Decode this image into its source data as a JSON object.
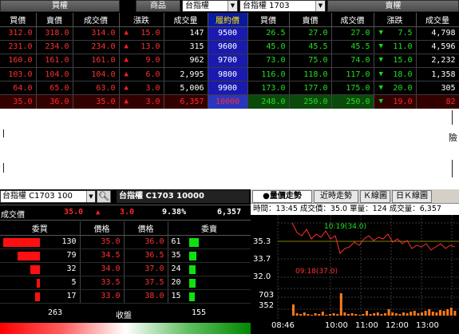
{
  "header": {
    "buy_call_label": "買權",
    "product_label": "商品",
    "product_select": "台指權",
    "contract_select": "台指權  1703",
    "sell_put_label": "賣權"
  },
  "quote_table": {
    "columns": [
      "買價",
      "賣價",
      "成交價",
      "漲跌",
      "成交量",
      "履約價",
      "買價",
      "賣價",
      "成交價",
      "漲跌",
      "成交量"
    ],
    "rows": [
      {
        "c_bid": "312.0",
        "c_ask": "318.0",
        "c_last": "314.0",
        "c_dir": "up",
        "c_chg": "15.0",
        "c_vol": "147",
        "strike": "9500",
        "p_bid": "26.5",
        "p_ask": "27.0",
        "p_last": "27.0",
        "p_dir": "down",
        "p_chg": "7.5",
        "p_vol": "4,798"
      },
      {
        "c_bid": "231.0",
        "c_ask": "234.0",
        "c_last": "234.0",
        "c_dir": "up",
        "c_chg": "13.0",
        "c_vol": "315",
        "strike": "9600",
        "p_bid": "45.0",
        "p_ask": "45.5",
        "p_last": "45.5",
        "p_dir": "down",
        "p_chg": "11.0",
        "p_vol": "4,596"
      },
      {
        "c_bid": "160.0",
        "c_ask": "161.0",
        "c_last": "161.0",
        "c_dir": "up",
        "c_chg": "9.0",
        "c_vol": "962",
        "strike": "9700",
        "p_bid": "73.0",
        "p_ask": "75.0",
        "p_last": "74.0",
        "p_dir": "down",
        "p_chg": "15.0",
        "p_vol": "2,232"
      },
      {
        "c_bid": "103.0",
        "c_ask": "104.0",
        "c_last": "104.0",
        "c_dir": "up",
        "c_chg": "6.0",
        "c_vol": "2,995",
        "strike": "9800",
        "p_bid": "116.0",
        "p_ask": "118.0",
        "p_last": "117.0",
        "p_dir": "down",
        "p_chg": "18.0",
        "p_vol": "1,358"
      },
      {
        "c_bid": "64.0",
        "c_ask": "65.0",
        "c_last": "63.0",
        "c_dir": "up",
        "c_chg": "3.0",
        "c_vol": "5,006",
        "strike": "9900",
        "p_bid": "173.0",
        "p_ask": "177.0",
        "p_last": "175.0",
        "p_dir": "down",
        "p_chg": "20.0",
        "p_vol": "305"
      },
      {
        "c_bid": "35.0",
        "c_ask": "36.0",
        "c_last": "35.0",
        "c_dir": "up",
        "c_chg": "3.0",
        "c_vol": "6,357",
        "strike": "10000",
        "p_bid": "248.0",
        "p_ask": "250.0",
        "p_last": "250.0",
        "p_dir": "down",
        "p_chg": "19.0",
        "p_vol": "82"
      }
    ]
  },
  "blank_area": {
    "edge_text": "險"
  },
  "detail": {
    "contract_select": "台指權  C1703  100",
    "title": "台指權  C1703  10000",
    "last_label": "成交價",
    "last_price": "35.0",
    "change": "3.0",
    "change_pct": "9.38%",
    "volume": "6,357"
  },
  "order_book": {
    "headers": [
      "委買",
      "價格",
      "價格",
      "委賣"
    ],
    "rows": [
      {
        "bid_qty": "130",
        "bid_px": "35.0",
        "ask_px": "36.0",
        "ask_qty": "61"
      },
      {
        "bid_qty": "79",
        "bid_px": "34.5",
        "ask_px": "36.5",
        "ask_qty": "35"
      },
      {
        "bid_qty": "32",
        "bid_px": "34.0",
        "ask_px": "37.0",
        "ask_qty": "24"
      },
      {
        "bid_qty": "5",
        "bid_px": "33.5",
        "ask_px": "37.5",
        "ask_qty": "20"
      },
      {
        "bid_qty": "17",
        "bid_px": "33.0",
        "ask_px": "38.0",
        "ask_qty": "15"
      }
    ],
    "total_bid": "263",
    "close_label": "收盤",
    "total_ask": "155"
  },
  "chart_tabs": [
    "●量價走勢",
    "近時走勢",
    "Ｋ線圖",
    "日Ｋ線圖"
  ],
  "chart_info": "時間：13:45  成交價：35.0  單量：124  成交量：6,357",
  "chart_data": {
    "type": "line",
    "price_axis": [
      "35.3",
      "33.7",
      "32.0"
    ],
    "volume_axis": [
      "703",
      "352"
    ],
    "x_labels": [
      "08:46",
      "10:00",
      "11:00",
      "12:00",
      "13:00"
    ],
    "annotations": {
      "high": "10:19(34.0)",
      "low": "09:18(37.0)"
    }
  },
  "colors": {
    "up": "#ff2020",
    "down": "#10e010",
    "strike_bg": "#1a1ab0"
  }
}
